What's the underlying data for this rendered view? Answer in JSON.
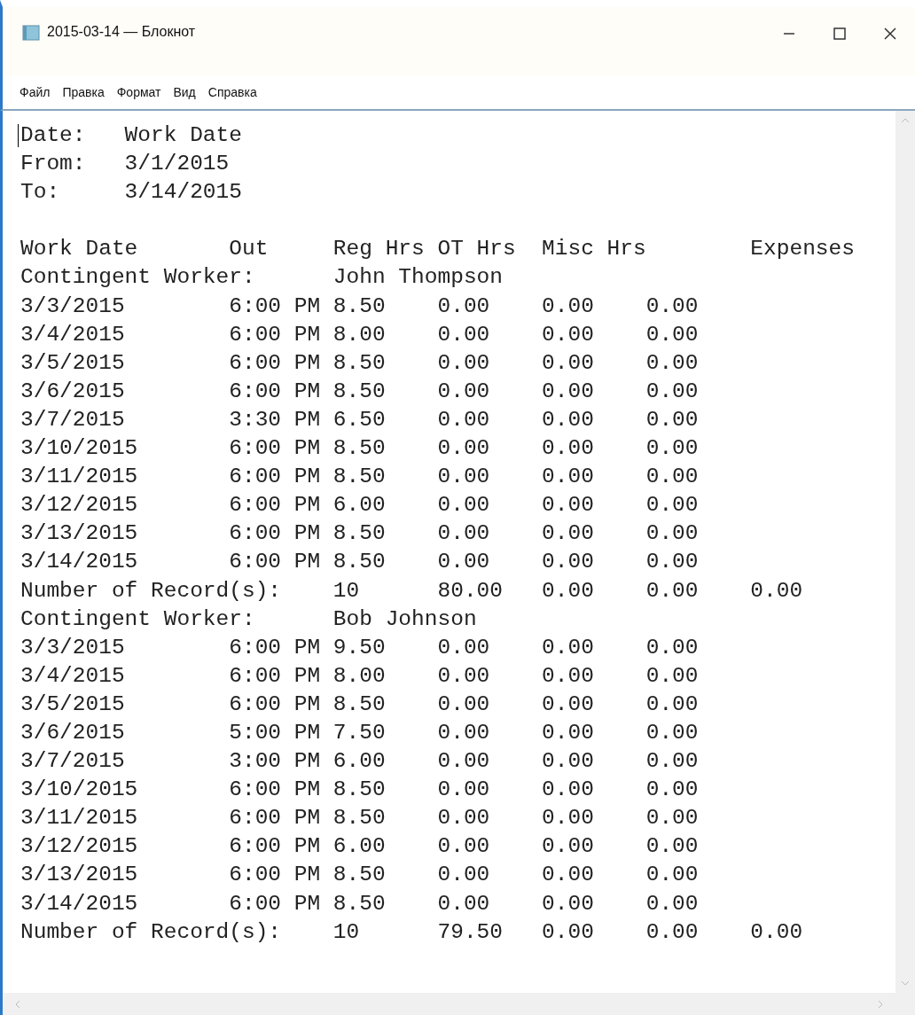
{
  "window": {
    "title": "2015-03-14 — Блокнот"
  },
  "menu": [
    "Файл",
    "Правка",
    "Формат",
    "Вид",
    "Справка"
  ],
  "document": {
    "header_lines": [
      "Date:   Work Date",
      "From:   3/1/2015",
      "To:     3/14/2015"
    ],
    "report_lines": [
      "Work Date       Out     Reg Hrs OT Hrs  Misc Hrs        Expenses",
      "Contingent Worker:      John Thompson",
      "3/3/2015        6:00 PM 8.50    0.00    0.00    0.00",
      "3/4/2015        6:00 PM 8.00    0.00    0.00    0.00",
      "3/5/2015        6:00 PM 8.50    0.00    0.00    0.00",
      "3/6/2015        6:00 PM 8.50    0.00    0.00    0.00",
      "3/7/2015        3:30 PM 6.50    0.00    0.00    0.00",
      "3/10/2015       6:00 PM 8.50    0.00    0.00    0.00",
      "3/11/2015       6:00 PM 8.50    0.00    0.00    0.00",
      "3/12/2015       6:00 PM 6.00    0.00    0.00    0.00",
      "3/13/2015       6:00 PM 8.50    0.00    0.00    0.00",
      "3/14/2015       6:00 PM 8.50    0.00    0.00    0.00",
      "Number of Record(s):    10      80.00   0.00    0.00    0.00",
      "Contingent Worker:      Bob Johnson",
      "3/3/2015        6:00 PM 9.50    0.00    0.00    0.00",
      "3/4/2015        6:00 PM 8.00    0.00    0.00    0.00",
      "3/5/2015        6:00 PM 8.50    0.00    0.00    0.00",
      "3/6/2015        5:00 PM 7.50    0.00    0.00    0.00",
      "3/7/2015        3:00 PM 6.00    0.00    0.00    0.00",
      "3/10/2015       6:00 PM 8.50    0.00    0.00    0.00",
      "3/11/2015       6:00 PM 8.50    0.00    0.00    0.00",
      "3/12/2015       6:00 PM 6.00    0.00    0.00    0.00",
      "3/13/2015       6:00 PM 8.50    0.00    0.00    0.00",
      "3/14/2015       6:00 PM 8.50    0.00    0.00    0.00",
      "Number of Record(s):    10      79.50   0.00    0.00    0.00"
    ]
  }
}
